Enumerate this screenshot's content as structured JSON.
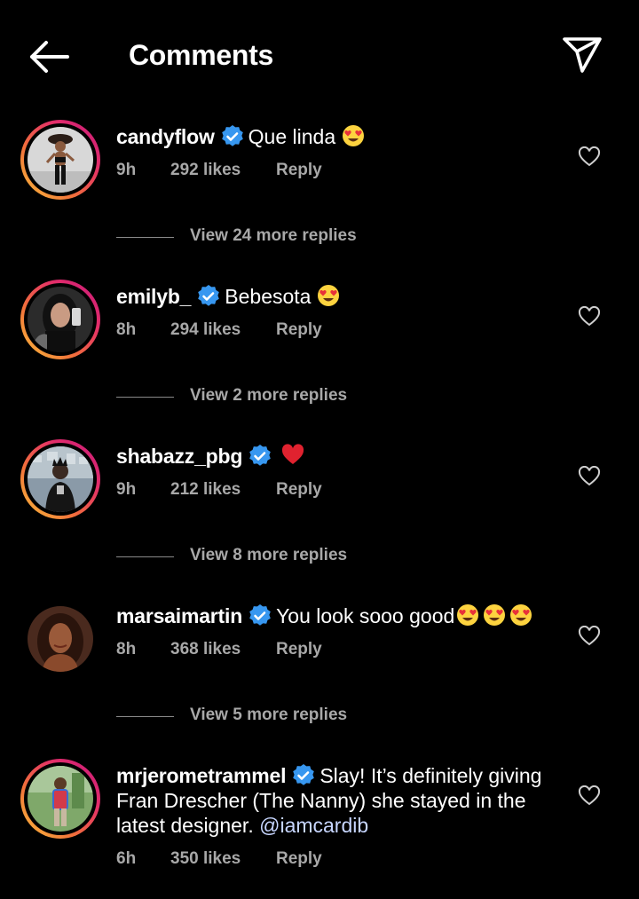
{
  "header": {
    "title": "Comments"
  },
  "comments": [
    {
      "username": "candyflow",
      "text": "Que linda ",
      "emojis": [
        "heart-eyes"
      ],
      "time": "9h",
      "likes": "292 likes",
      "reply": "Reply",
      "view_replies": "View 24 more replies"
    },
    {
      "username": "emilyb_",
      "text": "Bebesota ",
      "emojis": [
        "heart-eyes"
      ],
      "time": "8h",
      "likes": "294 likes",
      "reply": "Reply",
      "view_replies": "View 2 more replies"
    },
    {
      "username": "shabazz_pbg",
      "text": "",
      "emojis": [
        "red-heart"
      ],
      "time": "9h",
      "likes": "212 likes",
      "reply": "Reply",
      "view_replies": "View 8 more replies"
    },
    {
      "username": "marsaimartin",
      "text": "You look sooo good",
      "emojis": [
        "heart-eyes",
        "heart-eyes",
        "heart-eyes"
      ],
      "time": "8h",
      "likes": "368 likes",
      "reply": "Reply",
      "view_replies": "View 5 more replies"
    },
    {
      "username": "mrjerometrammel",
      "text": "Slay! It’s definitely giving Fran Drescher (The Nanny) she stayed in the latest designer. ",
      "mention": "@iamcardib",
      "time": "6h",
      "likes": "350 likes",
      "reply": "Reply"
    }
  ],
  "colors": {
    "background": "#000000",
    "verified": "#3797f0",
    "meta": "#a8a8a8",
    "mention": "#c7d6ff"
  }
}
